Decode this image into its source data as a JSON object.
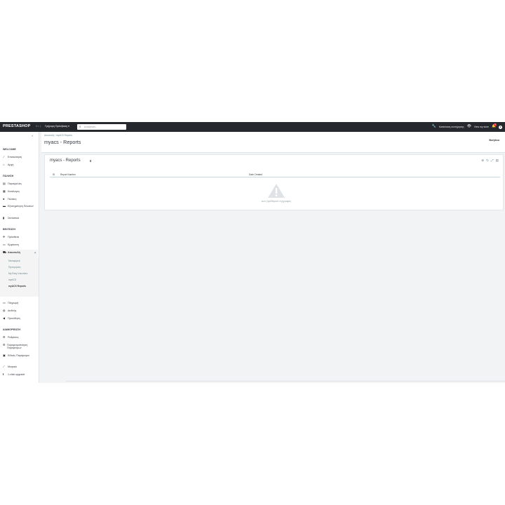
{
  "topbar": {
    "logo": "PRESTASHOP",
    "version": "8.1.1",
    "quick_access": "Γρήγορη Πρόσβαση",
    "search_placeholder": "Αναζήτηση",
    "maintenance": "Κατάσταση συντήρησης",
    "view_store": "View my store",
    "notifications_count": "1"
  },
  "sidebar": {
    "sections": [
      {
        "title": "WELCOME",
        "items": [
          {
            "icon": "trend-icon",
            "label": "Επισκόπηση"
          },
          {
            "icon": "home-icon",
            "label": "Αρχή"
          }
        ]
      },
      {
        "title": "ΠΩΛΗΣΗ",
        "items": [
          {
            "icon": "inbox-icon",
            "label": "Παραγγελίες"
          },
          {
            "icon": "store-icon",
            "label": "Κατάλογος"
          },
          {
            "icon": "user-icon",
            "label": "Πελάτες"
          },
          {
            "icon": "chat-icon",
            "label": "Εξυπηρέτηση Πελατών"
          },
          {
            "icon": "chart-icon",
            "label": "Στατιστικά"
          }
        ]
      },
      {
        "title": "ΒΕΛΤΙΩΣΗ",
        "items": [
          {
            "icon": "puzzle-icon",
            "label": "Πρόσθετα"
          },
          {
            "icon": "desktop-icon",
            "label": "Εμφάνιση"
          },
          {
            "icon": "truck-icon",
            "label": "Αποστολή",
            "expanded": true
          },
          {
            "icon": "card-icon",
            "label": "Πληρωμή"
          },
          {
            "icon": "globe-icon",
            "label": "Διεθνής"
          },
          {
            "icon": "speaker-icon",
            "label": "Προώθηση"
          }
        ]
      },
      {
        "title": "ΔΙΑΜΟΡΦΩΣΗ",
        "items": [
          {
            "icon": "gear-icon",
            "label": "Ρυθμίσεις"
          },
          {
            "icon": "settings-icon",
            "label": "Παραμετροποίηση Παραμέτρων"
          },
          {
            "icon": "advanced-icon",
            "label": "Ειδικές Παράμετροι"
          },
          {
            "icon": "trend-icon",
            "label": "Μετρικά"
          },
          {
            "icon": "info-icon",
            "label": "1-click upgrade"
          }
        ]
      }
    ],
    "subitems": [
      "Μεταφορείς",
      "Προτιμήσεις",
      "My Easy Vouchers",
      "myACS",
      "myACS Reports"
    ]
  },
  "header": {
    "breadcrumb": "Αποστολή  /  myACS Reports",
    "title": "myacs - Reports",
    "help": "Βοήθεια"
  },
  "panel": {
    "title": "myacs - Reports",
    "count": "0",
    "columns": [
      "ID",
      "Report Number",
      "Date Created"
    ],
    "empty_message": "Δεν βρέθηκαν εγγραφές"
  }
}
